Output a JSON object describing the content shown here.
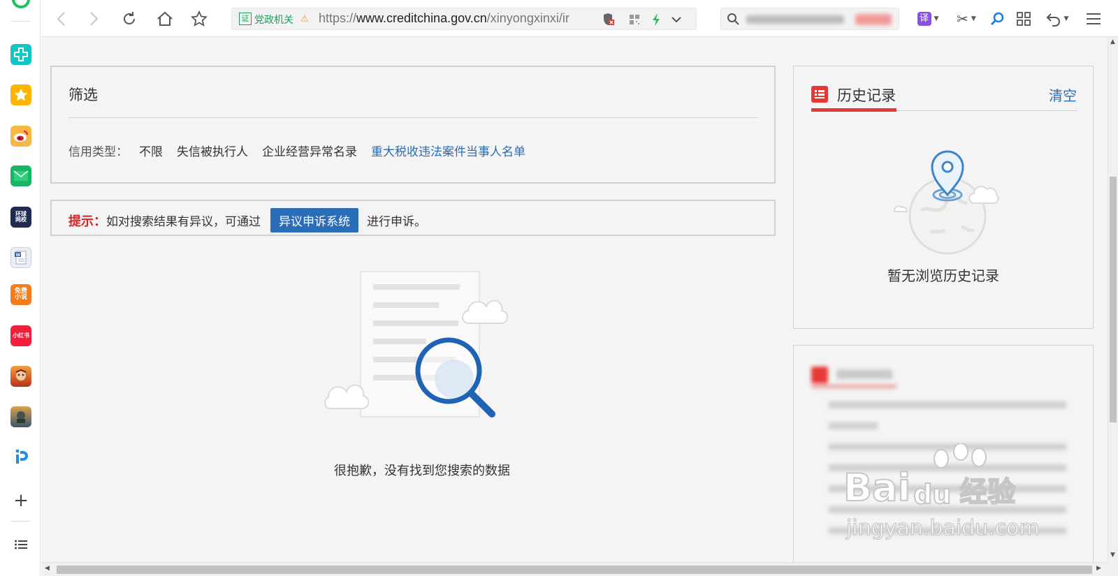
{
  "browser": {
    "cert_badge": "证",
    "cert_label": "党政机关",
    "url_prefix": "https://",
    "url_host": "www.creditchina.gov.cn",
    "url_path": "/xinyongxinxi/ir",
    "translate_label": "译"
  },
  "filter": {
    "title": "筛选",
    "credit_type_label": "信用类型：",
    "options": [
      "不限",
      "失信被执行人",
      "企业经营异常名录",
      "重大税收违法案件当事人名单"
    ],
    "active_option": "重大税收违法案件当事人名单"
  },
  "notice": {
    "prefix": "提示：",
    "text_before": "如对搜索结果有异议，可通过",
    "button_label": "异议申诉系统",
    "text_after": "进行申诉。"
  },
  "empty_result": {
    "message": "很抱歉，没有找到您搜索的数据"
  },
  "history": {
    "title": "历史记录",
    "clear_label": "清空",
    "empty_message": "暂无浏览历史记录"
  },
  "watermark": {
    "brand_a": "Bai",
    "brand_b": "du",
    "brand_c": "经验",
    "url": "jingyan.baidu.com"
  },
  "sidebar_apps": [
    {
      "icon": "health-plus-icon",
      "color": "#12c4c4"
    },
    {
      "icon": "favorites-star-icon",
      "color": "#ffb400"
    },
    {
      "icon": "weibo-icon",
      "color": "#f5a623"
    },
    {
      "icon": "mail-icon",
      "color": "#18b566"
    },
    {
      "icon": "global-times-icon",
      "color": "#1e2b4f",
      "text": "环球网校"
    },
    {
      "icon": "word-doc-icon",
      "color": "#e9eef7"
    },
    {
      "icon": "free-novel-icon",
      "color": "#f37d1c",
      "text": "免费小说"
    },
    {
      "icon": "xiaohongshu-icon",
      "color": "#f01f3b",
      "text": "小红书"
    },
    {
      "icon": "game-hero-icon",
      "color": "#d8562b"
    },
    {
      "icon": "game-pubg-icon",
      "color": "#5a7d9a"
    },
    {
      "icon": "p-app-icon",
      "color": "#ffffff"
    }
  ],
  "colors": {
    "accent_blue": "#2b6cb7",
    "notice_red": "#e02020",
    "history_red": "#e53935"
  }
}
